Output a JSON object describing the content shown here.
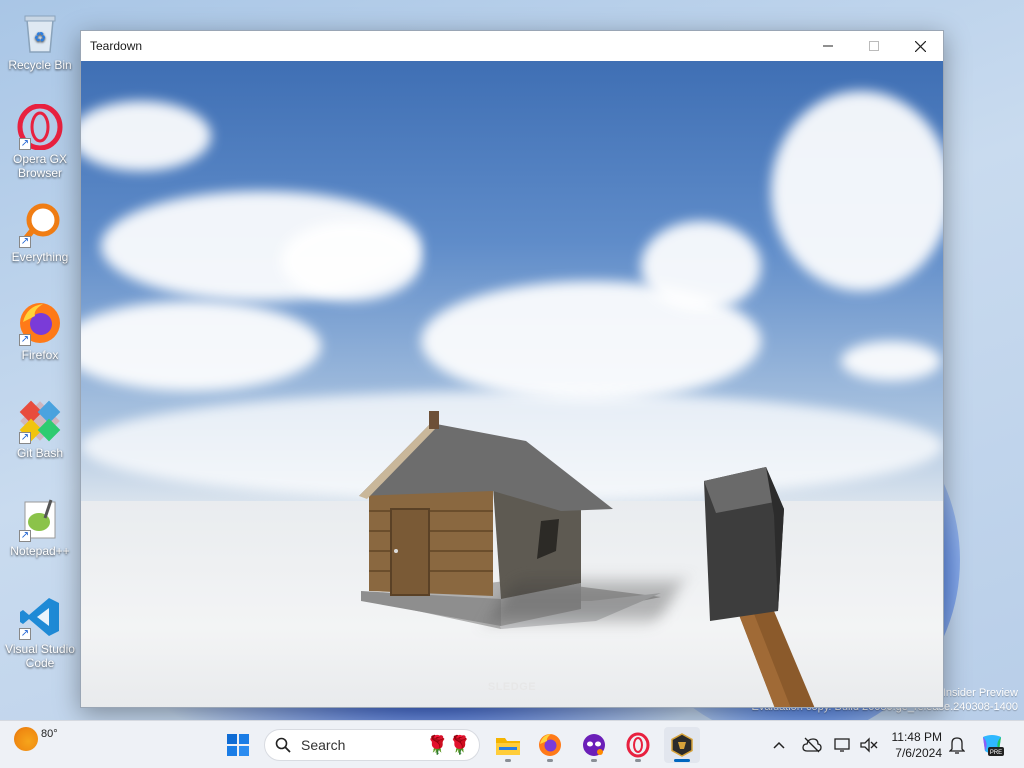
{
  "desktop": {
    "icons": [
      {
        "label": "Recycle Bin"
      },
      {
        "label": "Opera GX Browser"
      },
      {
        "label": "Everything"
      },
      {
        "label": "Firefox"
      },
      {
        "label": "Git Bash"
      },
      {
        "label": "Notepad++"
      },
      {
        "label": "Visual Studio Code"
      }
    ],
    "watermark_line1": "Insider Preview",
    "watermark_line2": "Evaluation copy. Build 26080.ge_release.240308-1400"
  },
  "window": {
    "title": "Teardown",
    "hud_tool": "SLEDGE"
  },
  "taskbar": {
    "weather_temp": "80°",
    "search_placeholder": "Search",
    "time": "11:48 PM",
    "date": "7/6/2024",
    "copilot_badge": "PRE"
  },
  "colors": {
    "accent": "#0067c0",
    "sky_top": "#3f6fb4",
    "ground": "#eef0f2"
  }
}
